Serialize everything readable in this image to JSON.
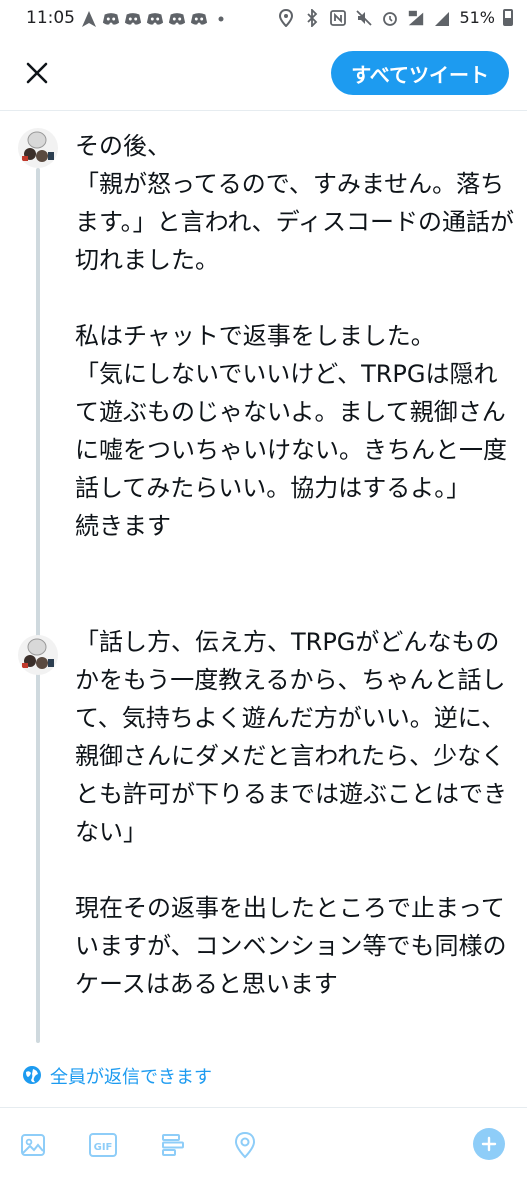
{
  "status_bar": {
    "time": "11:05",
    "battery_percent": "51%"
  },
  "header": {
    "close_icon": "close-icon",
    "tweet_all_label": "すべてツイート"
  },
  "thread": {
    "tweets": [
      {
        "text": "その後、\n「親が怒ってるので、すみません。落ちます。」と言われ、ディスコードの通話が切れました。\n\n私はチャットで返事をしました。\n「気にしないでいいけど、TRPGは隠れて遊ぶものじゃないよ。まして親御さんに嘘をついちゃいけない。きちんと一度話してみたらいい。協力はするよ。」\n続きます"
      },
      {
        "text": "「話し方、伝え方、TRPGがどんなものかをもう一度教えるから、ちゃんと話して、気持ちよく遊んだ方がいい。逆に、親御さんにダメだと言われたら、少なくとも許可が下りるまでは遊ぶことはできない」\n\n現在その返事を出したところで止まっていますが、コンベンション等でも同様のケースはあると思います"
      }
    ]
  },
  "reply_permission": {
    "label": "全員が返信できます",
    "icon": "globe-icon"
  },
  "toolbar": {
    "icons": [
      "image-icon",
      "gif-icon",
      "poll-icon",
      "location-icon",
      "add-tweet-icon"
    ],
    "gif_label": "GIF"
  },
  "colors": {
    "accent": "#1d9bf0",
    "thread_line": "#cfd9de",
    "text": "#0f1419"
  }
}
